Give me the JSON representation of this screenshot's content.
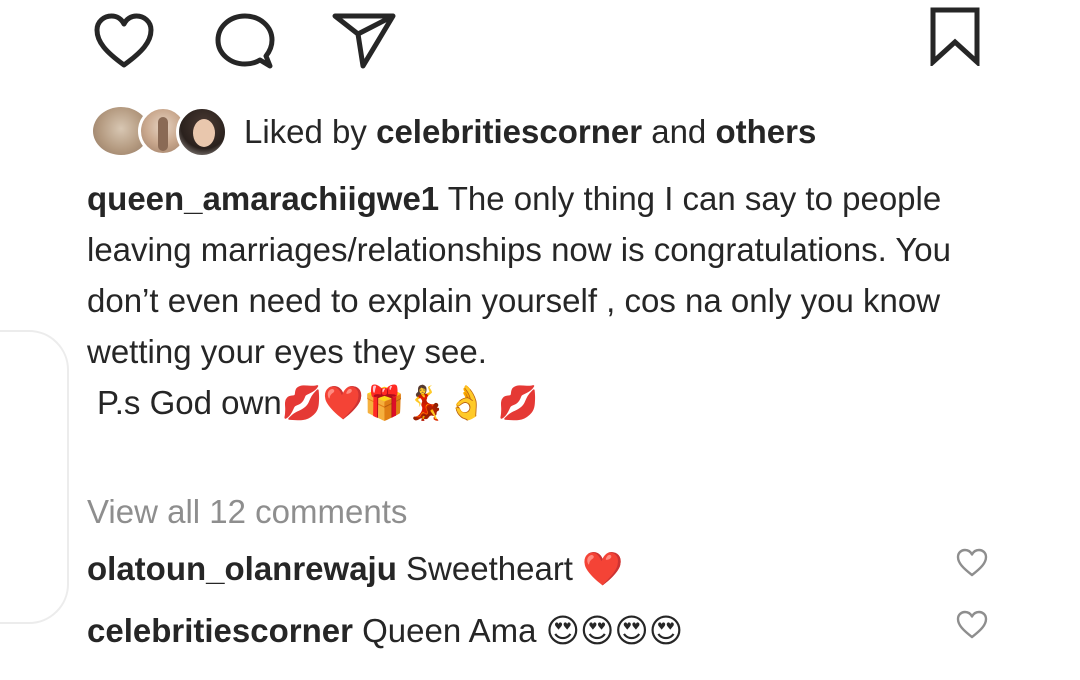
{
  "actions": {
    "like_icon": "heart-icon",
    "comment_icon": "comment-bubble-icon",
    "share_icon": "paper-plane-icon",
    "save_icon": "bookmark-icon"
  },
  "likes": {
    "prefix": "Liked by ",
    "user": "celebritiescorner",
    "connector": " and ",
    "others": "others"
  },
  "caption": {
    "username": "queen_amarachiigwe1",
    "text": " The only thing I can say to people leaving marriages/relationships now is congratulations. You don’t even need to explain yourself , cos na only you know wetting your eyes they see.",
    "ps_text": "P.s God own",
    "ps_emojis": "💋❤️🎁💃👌 💋"
  },
  "view_all_comments": "View all 12 comments",
  "comments": [
    {
      "username": "olatoun_olanrewaju",
      "text": " Sweetheart ",
      "emoji": "❤️"
    },
    {
      "username": "celebritiescorner",
      "text": " Queen Ama ",
      "emoji": "😍😍😍😍"
    }
  ],
  "colors": {
    "text": "#262626",
    "muted": "#8e8e8e",
    "heart_red": "#ed4956",
    "icon_stroke": "#262626"
  }
}
